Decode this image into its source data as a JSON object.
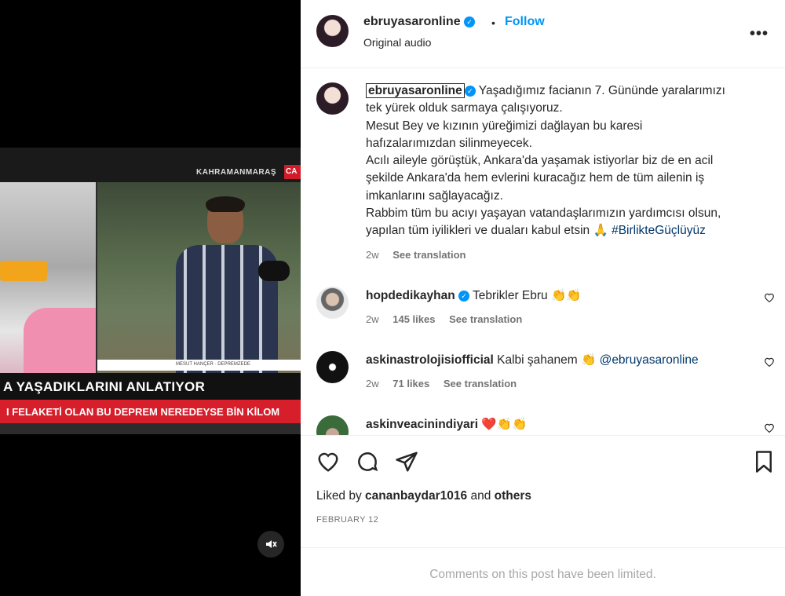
{
  "post": {
    "username": "ebruyasaronline",
    "follow_label": "Follow",
    "separator": "•",
    "audio": "Original audio",
    "more_label": "•••"
  },
  "video": {
    "city": "KAHRAMANMARAŞ",
    "tag": "CA",
    "small_caption": "MESUT HANÇER · DEPREMZEDE",
    "banner_main": "A YAŞADIKLARINI ANLATIYOR",
    "banner_ticker": "I FELAKETİ OLAN BU DEPREM NEREDEYSE BİN KİLOM",
    "mute_icon": "speaker-muted-icon"
  },
  "caption": {
    "username": "ebruyasaronline",
    "lines": [
      "Yaşadığımız facianın 7. Gününde yaralarımızı",
      "tek yürek olduk sarmaya çalışıyoruz.",
      "Mesut Bey ve kızının yüreğimizi dağlayan bu karesi",
      "hafızalarımızdan silinmeyecek.",
      "Acılı aileyle görüştük, Ankara'da yaşamak istiyorlar biz de en acil",
      "şekilde Ankara'da hem evlerini kuracağız hem de tüm ailenin iş",
      "imkanlarını sağlayacağız.",
      "Rabbim tüm bu acıyı yaşayan vatandaşlarımızın yardımcısı olsun,",
      "yapılan tüm iyilikleri ve duaları kabul etsin 🙏 "
    ],
    "hashtag": "#BirlikteGüçlüyüz",
    "time": "2w",
    "see_translation": "See translation"
  },
  "comments": [
    {
      "username": "hopdedikayhan",
      "verified": true,
      "text": "Tebrikler Ebru 👏👏",
      "time": "2w",
      "likes": "145 likes",
      "see_translation": "See translation"
    },
    {
      "username": "askinastrolojisiofficial",
      "verified": false,
      "text": "Kalbi şahanem 👏 ",
      "mention": "@ebruyasaronline",
      "time": "2w",
      "likes": "71 likes",
      "see_translation": "See translation"
    },
    {
      "username": "askinveacinindiyari",
      "verified": false,
      "text": "❤️👏👏"
    }
  ],
  "actions": {
    "liked_prefix": "Liked by ",
    "liked_user": "cananbaydar1016",
    "liked_and": " and ",
    "liked_others": "others",
    "date": "FEBRUARY 12"
  },
  "footer": {
    "limited": "Comments on this post have been limited."
  },
  "colors": {
    "accent": "#0095f6",
    "link": "#00376b",
    "secondary_text": "#737373"
  }
}
